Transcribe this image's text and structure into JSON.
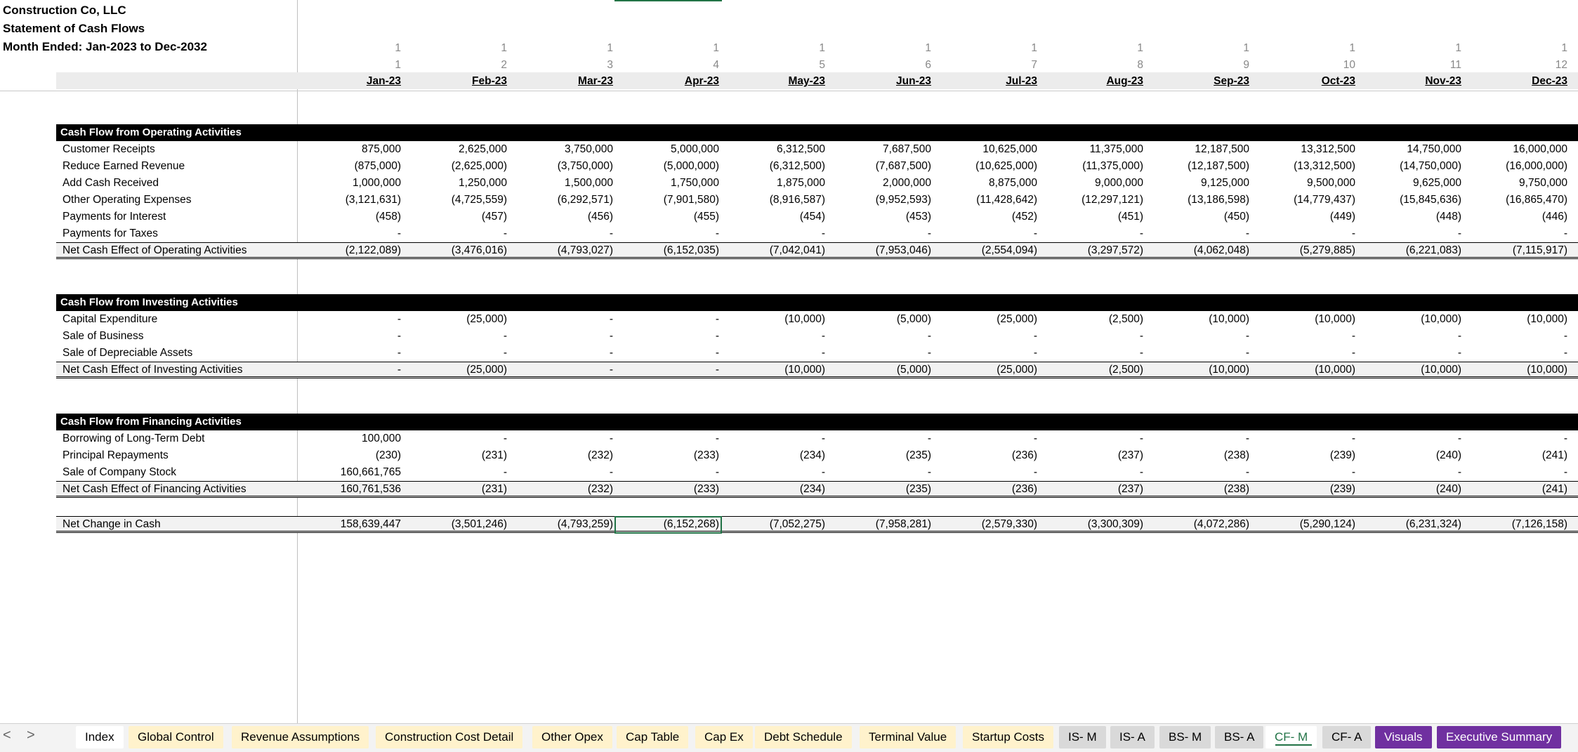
{
  "company": "Construction Co, LLC",
  "statement": "Statement of Cash Flows",
  "period": "Month Ended: Jan-2023 to Dec-2032",
  "year_index": [
    "1",
    "1",
    "1",
    "1",
    "1",
    "1",
    "1",
    "1",
    "1",
    "1",
    "1",
    "1"
  ],
  "month_index": [
    "1",
    "2",
    "3",
    "4",
    "5",
    "6",
    "7",
    "8",
    "9",
    "10",
    "11",
    "12"
  ],
  "months": [
    "Jan-23",
    "Feb-23",
    "Mar-23",
    "Apr-23",
    "May-23",
    "Jun-23",
    "Jul-23",
    "Aug-23",
    "Sep-23",
    "Oct-23",
    "Nov-23",
    "Dec-23"
  ],
  "sections": [
    {
      "title": "Cash Flow from Operating Activities",
      "rows": [
        {
          "label": "Customer Receipts",
          "values": [
            "875,000",
            "2,625,000",
            "3,750,000",
            "5,000,000",
            "6,312,500",
            "7,687,500",
            "10,625,000",
            "11,375,000",
            "12,187,500",
            "13,312,500",
            "14,750,000",
            "16,000,000"
          ]
        },
        {
          "label": "Reduce Earned Revenue",
          "values": [
            "(875,000)",
            "(2,625,000)",
            "(3,750,000)",
            "(5,000,000)",
            "(6,312,500)",
            "(7,687,500)",
            "(10,625,000)",
            "(11,375,000)",
            "(12,187,500)",
            "(13,312,500)",
            "(14,750,000)",
            "(16,000,000)"
          ]
        },
        {
          "label": "Add Cash Received",
          "values": [
            "1,000,000",
            "1,250,000",
            "1,500,000",
            "1,750,000",
            "1,875,000",
            "2,000,000",
            "8,875,000",
            "9,000,000",
            "9,125,000",
            "9,500,000",
            "9,625,000",
            "9,750,000"
          ]
        },
        {
          "label": "Other Operating Expenses",
          "values": [
            "(3,121,631)",
            "(4,725,559)",
            "(6,292,571)",
            "(7,901,580)",
            "(8,916,587)",
            "(9,952,593)",
            "(11,428,642)",
            "(12,297,121)",
            "(13,186,598)",
            "(14,779,437)",
            "(15,845,636)",
            "(16,865,470)"
          ]
        },
        {
          "label": "Payments for Interest",
          "values": [
            "(458)",
            "(457)",
            "(456)",
            "(455)",
            "(454)",
            "(453)",
            "(452)",
            "(451)",
            "(450)",
            "(449)",
            "(448)",
            "(446)"
          ]
        },
        {
          "label": "Payments for Taxes",
          "values": [
            "-",
            "-",
            "-",
            "-",
            "-",
            "-",
            "-",
            "-",
            "-",
            "-",
            "-",
            "-"
          ]
        }
      ],
      "total": {
        "label": "Net Cash Effect of Operating Activities",
        "values": [
          "(2,122,089)",
          "(3,476,016)",
          "(4,793,027)",
          "(6,152,035)",
          "(7,042,041)",
          "(7,953,046)",
          "(2,554,094)",
          "(3,297,572)",
          "(4,062,048)",
          "(5,279,885)",
          "(6,221,083)",
          "(7,115,917)"
        ]
      }
    },
    {
      "title": "Cash Flow from Investing Activities",
      "rows": [
        {
          "label": "Capital Expenditure",
          "values": [
            "-",
            "(25,000)",
            "-",
            "-",
            "(10,000)",
            "(5,000)",
            "(25,000)",
            "(2,500)",
            "(10,000)",
            "(10,000)",
            "(10,000)",
            "(10,000)"
          ]
        },
        {
          "label": "Sale of Business",
          "values": [
            "-",
            "-",
            "-",
            "-",
            "-",
            "-",
            "-",
            "-",
            "-",
            "-",
            "-",
            "-"
          ]
        },
        {
          "label": "Sale of Depreciable Assets",
          "values": [
            "-",
            "-",
            "-",
            "-",
            "-",
            "-",
            "-",
            "-",
            "-",
            "-",
            "-",
            "-"
          ]
        }
      ],
      "total": {
        "label": "Net Cash Effect of Investing Activities",
        "values": [
          "-",
          "(25,000)",
          "-",
          "-",
          "(10,000)",
          "(5,000)",
          "(25,000)",
          "(2,500)",
          "(10,000)",
          "(10,000)",
          "(10,000)",
          "(10,000)"
        ]
      }
    },
    {
      "title": "Cash Flow from Financing Activities",
      "rows": [
        {
          "label": "Borrowing of Long-Term Debt",
          "values": [
            "100,000",
            "-",
            "-",
            "-",
            "-",
            "-",
            "-",
            "-",
            "-",
            "-",
            "-",
            "-"
          ]
        },
        {
          "label": "Principal Repayments",
          "values": [
            "(230)",
            "(231)",
            "(232)",
            "(233)",
            "(234)",
            "(235)",
            "(236)",
            "(237)",
            "(238)",
            "(239)",
            "(240)",
            "(241)"
          ]
        },
        {
          "label": "Sale of Company Stock",
          "values": [
            "160,661,765",
            "-",
            "-",
            "-",
            "-",
            "-",
            "-",
            "-",
            "-",
            "-",
            "-",
            "-"
          ]
        }
      ],
      "total": {
        "label": "Net Cash Effect of Financing Activities",
        "values": [
          "160,761,536",
          "(231)",
          "(232)",
          "(233)",
          "(234)",
          "(235)",
          "(236)",
          "(237)",
          "(238)",
          "(239)",
          "(240)",
          "(241)"
        ]
      }
    }
  ],
  "net_change": {
    "label": "Net Change in Cash",
    "values": [
      "158,639,447",
      "(3,501,246)",
      "(4,793,259)",
      "(6,152,268)",
      "(7,052,275)",
      "(7,958,281)",
      "(2,579,330)",
      "(3,300,309)",
      "(4,072,286)",
      "(5,290,124)",
      "(6,231,324)",
      "(7,126,158)"
    ]
  },
  "nav": {
    "prev": "<",
    "next": ">"
  },
  "tabs": [
    {
      "label": "Index",
      "style": "white"
    },
    {
      "label": "Global Control",
      "style": "yellow"
    },
    {
      "label": "Revenue Assumptions",
      "style": "yellow"
    },
    {
      "label": "Construction Cost Detail",
      "style": "yellow"
    },
    {
      "label": "Other Opex",
      "style": "yellow"
    },
    {
      "label": "Cap Table",
      "style": "yellow"
    },
    {
      "label": "Cap Ex",
      "style": "yellow"
    },
    {
      "label": "Debt Schedule",
      "style": "yellow"
    },
    {
      "label": "Terminal Value",
      "style": "yellow"
    },
    {
      "label": "Startup Costs",
      "style": "yellow"
    },
    {
      "label": "IS- M",
      "style": "grayt"
    },
    {
      "label": "IS- A",
      "style": "grayt"
    },
    {
      "label": "BS- M",
      "style": "grayt"
    },
    {
      "label": "BS- A",
      "style": "grayt"
    },
    {
      "label": "CF- M",
      "style": "active"
    },
    {
      "label": "CF- A",
      "style": "grayt"
    },
    {
      "label": "Visuals",
      "style": "purple"
    },
    {
      "label": "Executive Summary",
      "style": "purple"
    }
  ],
  "colors": {
    "selection": "#217346",
    "tab_yellow": "#fff2cc",
    "tab_gray": "#d9d9d9",
    "tab_purple": "#7030a0"
  }
}
